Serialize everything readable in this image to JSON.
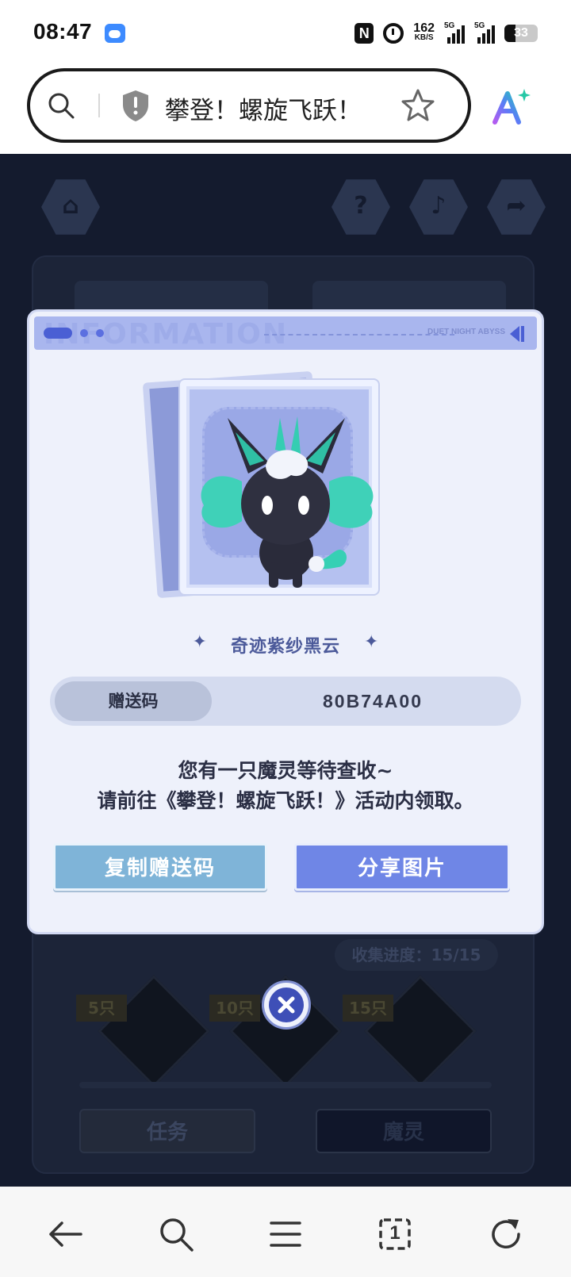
{
  "status_bar": {
    "time": "08:47",
    "net_speed": "162",
    "net_unit": "KB/S",
    "signal1_label": "5G",
    "signal2_label": "5G",
    "battery": "33",
    "icons": [
      "weather-icon",
      "nfc-icon",
      "alarm-icon",
      "signal-icon",
      "battery-icon"
    ]
  },
  "browser": {
    "address_title": "攀登！螺旋飞跃！",
    "icons": [
      "search-icon",
      "shield-icon",
      "star-icon",
      "ai-icon"
    ]
  },
  "game": {
    "watermark": "INFORMATION",
    "brand": "DUET NIGHT ABYSS",
    "progress": "收集进度：15/15",
    "milestones": [
      "5只",
      "10只",
      "15只"
    ],
    "tabs": [
      "任务",
      "魔灵"
    ]
  },
  "modal": {
    "pet_name": "奇迹紫纱黑云",
    "code_label": "赠送码",
    "code_value": "80B74A00",
    "message_line1": "您有一只魔灵等待查收~",
    "message_line2": "请前往《攀登！螺旋飞跃！》活动内领取。",
    "copy_button": "复制赠送码",
    "share_button": "分享图片"
  },
  "bottom_nav": {
    "tab_count": "1",
    "icons": [
      "back-icon",
      "search-icon",
      "menu-icon",
      "tabs-icon",
      "refresh-icon"
    ]
  },
  "colors": {
    "accent": "#6f86e6",
    "copy_button": "#7fb4d8",
    "game_bg": "#141b2e"
  }
}
